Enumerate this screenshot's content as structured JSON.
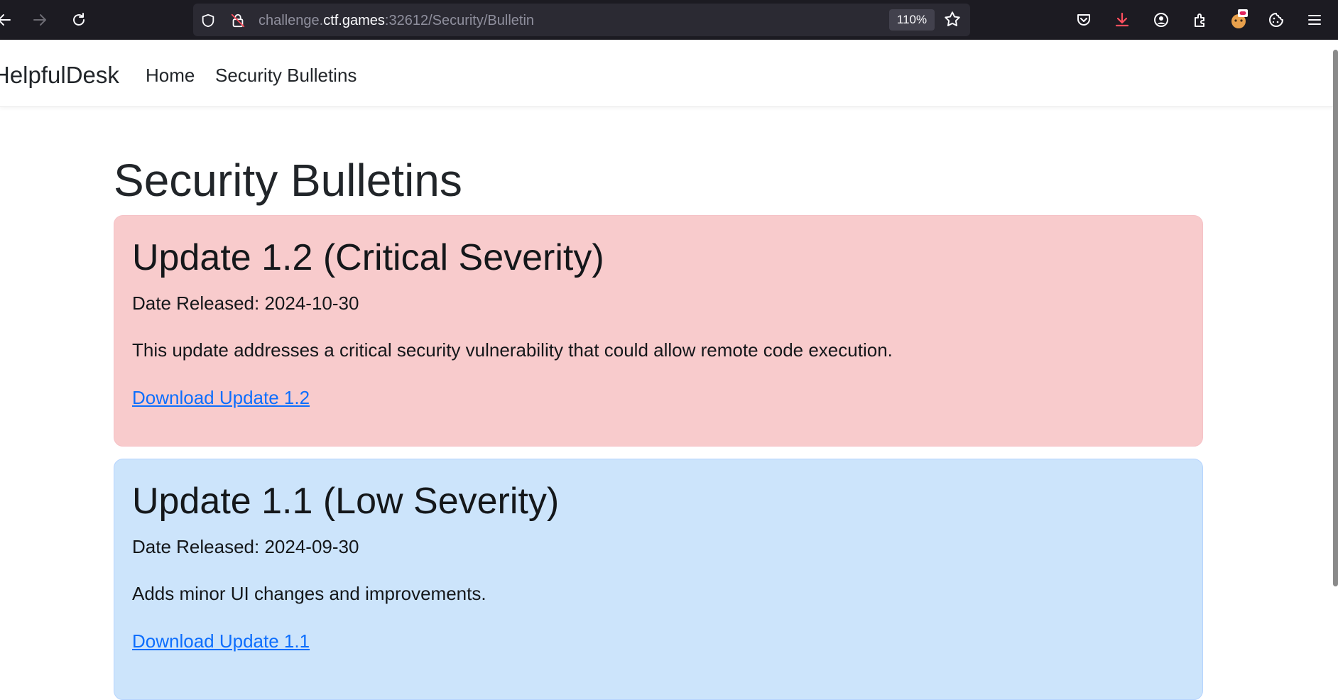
{
  "browser": {
    "url_prefix": "challenge.",
    "url_host": "ctf.games",
    "url_suffix": ":32612/Security/Bulletin",
    "zoom": "110%",
    "icons": {
      "back": "back-arrow-icon",
      "forward": "forward-arrow-icon",
      "reload": "reload-icon",
      "tracking": "shield-icon",
      "insecure": "insecure-lock-icon",
      "bookmark": "star-icon",
      "pocket": "pocket-icon",
      "downloads": "download-icon",
      "account": "account-icon",
      "extensions": "extensions-icon",
      "extension_badge": "extension-avatar-icon",
      "cookie": "cookie-icon",
      "menu": "hamburger-menu-icon"
    },
    "colors": {
      "download_icon": "#ff4f5e",
      "toolbar": "#1c1b22",
      "urlbar": "#2b2a33"
    }
  },
  "navbar": {
    "brand": "HelpfulDesk",
    "links": [
      "Home",
      "Security Bulletins"
    ]
  },
  "main": {
    "title": "Security Bulletins",
    "bulletins": [
      {
        "title": "Update 1.2 (Critical Severity)",
        "date": "Date Released: 2024-10-30",
        "description": "This update addresses a critical security vulnerability that could allow remote code execution.",
        "link": "Download Update 1.2",
        "color": "#f8cbcc"
      },
      {
        "title": "Update 1.1 (Low Severity)",
        "date": "Date Released: 2024-09-30",
        "description": "Adds minor UI changes and improvements.",
        "link": "Download Update 1.1",
        "color": "#cce4fb"
      }
    ]
  }
}
